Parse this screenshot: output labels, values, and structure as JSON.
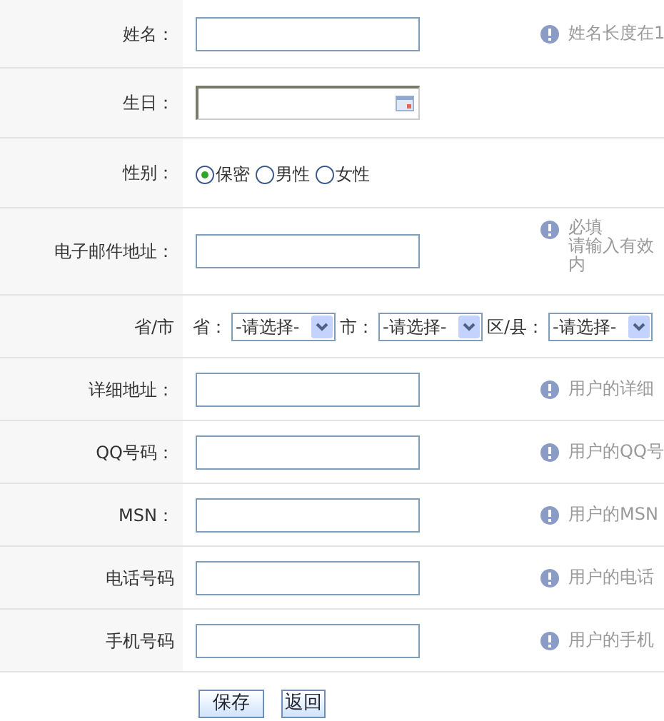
{
  "rows": [
    {
      "kind": "text",
      "label": "姓名：",
      "hint": [
        "姓名长度在1"
      ]
    },
    {
      "kind": "date",
      "label": "生日："
    },
    {
      "kind": "radio",
      "label": "性别：",
      "options": [
        {
          "label": "保密",
          "selected": true
        },
        {
          "label": "男性",
          "selected": false
        },
        {
          "label": "女性",
          "selected": false
        }
      ]
    },
    {
      "kind": "text",
      "label": "电子邮件地址：",
      "hint": [
        "必填",
        "请输入有效",
        "内"
      ]
    },
    {
      "kind": "region",
      "label": "省/市",
      "selects": [
        {
          "label": "省：",
          "value": "-请选择-"
        },
        {
          "label": "市：",
          "value": "-请选择-"
        },
        {
          "label": "区/县：",
          "value": "-请选择-"
        }
      ]
    },
    {
      "kind": "text",
      "label": "详细地址：",
      "hint": [
        "用户的详细"
      ]
    },
    {
      "kind": "text",
      "label": "QQ号码：",
      "hint": [
        "用户的QQ号"
      ]
    },
    {
      "kind": "text",
      "label": "MSN：",
      "hint": [
        "用户的MSN"
      ]
    },
    {
      "kind": "text",
      "label": "电话号码",
      "hint": [
        "用户的电话"
      ]
    },
    {
      "kind": "text",
      "label": "手机号码",
      "hint": [
        "用户的手机"
      ]
    }
  ],
  "buttons": [
    "保存",
    "返回"
  ]
}
